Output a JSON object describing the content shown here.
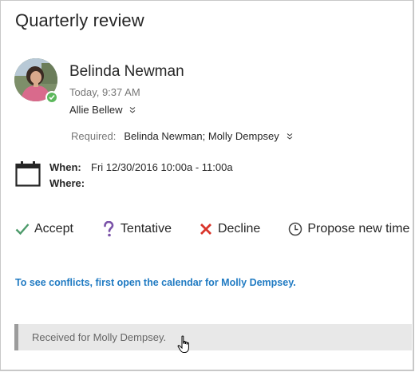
{
  "meeting": {
    "title": "Quarterly review"
  },
  "sender": {
    "name": "Belinda Newman",
    "time": "Today, 9:37 AM",
    "to": "Allie Bellew",
    "presence_color": "#5cb85c"
  },
  "attendees": {
    "required_label": "Required:",
    "required_value": "Belinda Newman; Molly Dempsey"
  },
  "details": {
    "when_label": "When:",
    "when_value": "Fri 12/30/2016 10:00a - 11:00a",
    "where_label": "Where:",
    "where_value": ""
  },
  "actions": [
    {
      "label": "Accept",
      "icon": "checkmark-icon",
      "color": "#4c9a6a"
    },
    {
      "label": "Tentative",
      "icon": "question-mark-icon",
      "color": "#7a52a8"
    },
    {
      "label": "Decline",
      "icon": "x-icon",
      "color": "#d9352b"
    },
    {
      "label": "Propose new time",
      "icon": "clock-icon",
      "color": "#444444"
    }
  ],
  "conflict": {
    "text": "To see conflicts, first open the calendar for Molly Dempsey.",
    "color": "#1f7ac2"
  },
  "received": {
    "text": "Received for Molly Dempsey."
  }
}
